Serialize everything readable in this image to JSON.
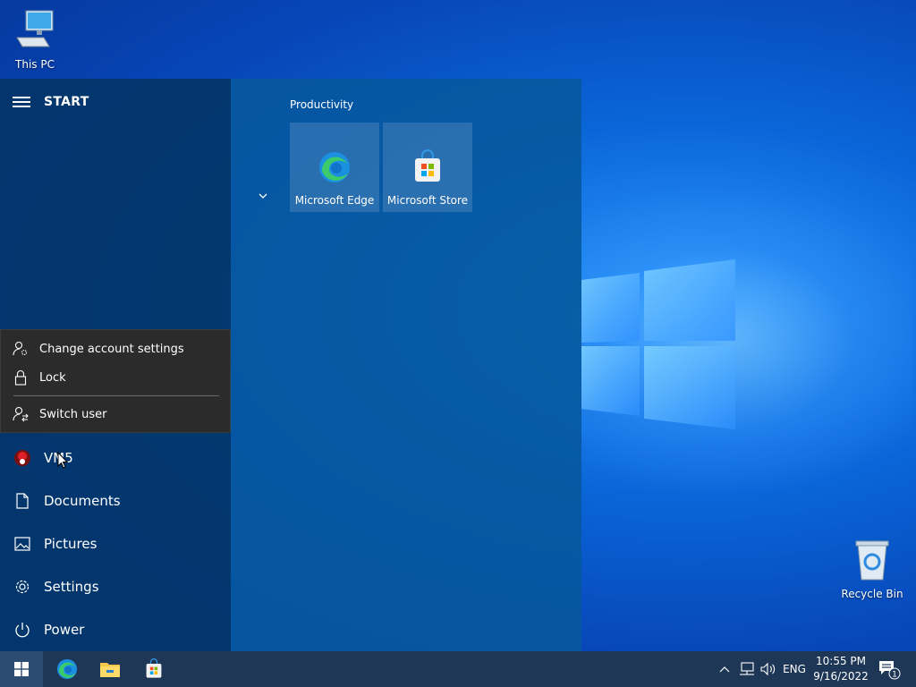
{
  "desktop": {
    "icons": [
      {
        "label": "This PC",
        "icon": "computer-icon"
      },
      {
        "label": "Recycle Bin",
        "icon": "recycle-bin-icon"
      }
    ]
  },
  "start": {
    "title": "START",
    "flyout": {
      "items": [
        {
          "label": "Change account settings",
          "icon": "user-settings-icon"
        },
        {
          "label": "Lock",
          "icon": "lock-icon"
        },
        {
          "label": "Switch user",
          "icon": "switch-user-icon"
        }
      ]
    },
    "nav": [
      {
        "label": "VM5",
        "icon": "user-avatar-icon"
      },
      {
        "label": "Documents",
        "icon": "document-icon"
      },
      {
        "label": "Pictures",
        "icon": "pictures-icon"
      },
      {
        "label": "Settings",
        "icon": "gear-icon"
      },
      {
        "label": "Power",
        "icon": "power-icon"
      }
    ],
    "group": {
      "title": "Productivity",
      "tiles": [
        {
          "label": "Microsoft Edge",
          "icon": "edge-icon"
        },
        {
          "label": "Microsoft Store",
          "icon": "store-icon"
        }
      ]
    }
  },
  "taskbar": {
    "pinned": [
      "start-icon",
      "edge-icon",
      "file-explorer-icon",
      "store-icon"
    ],
    "tray": {
      "language": "ENG",
      "time": "10:55 PM",
      "date": "9/16/2022",
      "notifications_count": "1"
    }
  },
  "colors": {
    "start_left": "#033668",
    "start_right": "#07589e",
    "taskbar": "#1e3757",
    "flyout": "#2b2b2b"
  }
}
